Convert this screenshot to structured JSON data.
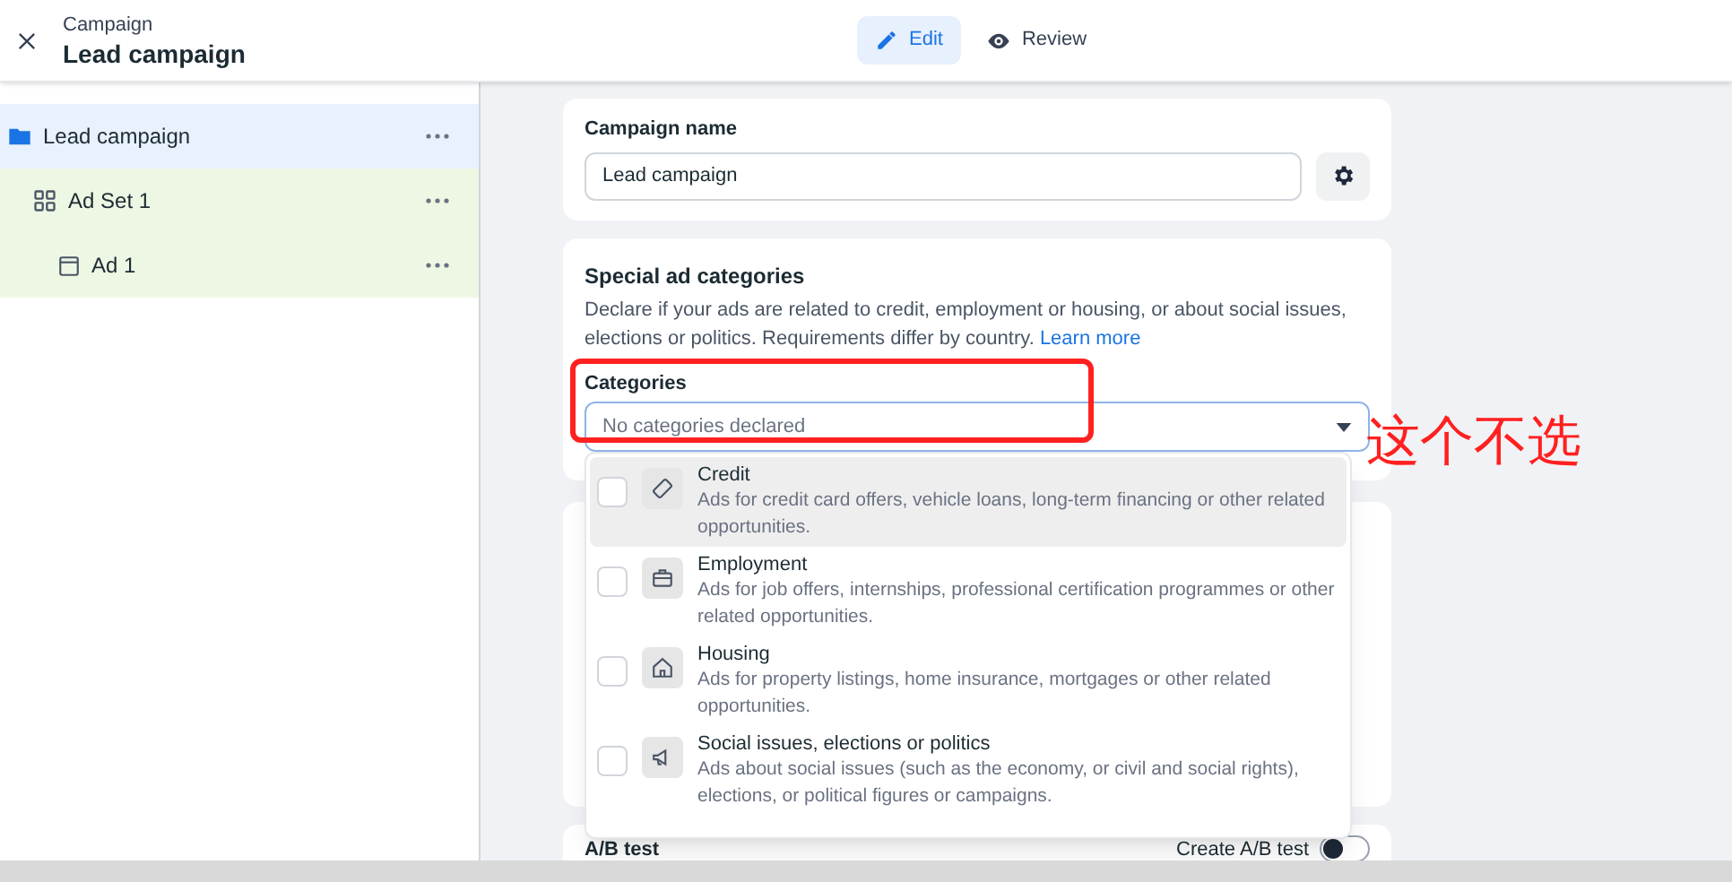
{
  "header": {
    "subtitle": "Campaign",
    "title": "Lead campaign"
  },
  "tabs": [
    {
      "label": "Edit",
      "kind": "edit",
      "selected": true
    },
    {
      "label": "Review",
      "kind": "review",
      "selected": false
    }
  ],
  "tree": [
    {
      "label": "Lead campaign",
      "kind": "campaign",
      "selected": true,
      "children": [
        {
          "label": "Ad Set 1",
          "kind": "adset",
          "selected": false,
          "children": [
            {
              "label": "Ad 1",
              "kind": "ad",
              "selected": false
            }
          ]
        }
      ]
    }
  ],
  "campaign_name": {
    "label": "Campaign name",
    "value": "Lead campaign"
  },
  "special_ad_categories": {
    "title": "Special ad categories",
    "description": "Declare if your ads are related to credit, employment or housing, or about social issues, elections or politics. Requirements differ by country.",
    "link": "Learn more",
    "field_label": "Categories",
    "placeholder": "No categories declared"
  },
  "category_options": [
    {
      "title": "Credit",
      "kind": "credit",
      "description": "Ads for credit card offers, vehicle loans, long-term financing or other related opportunities.",
      "checked": false,
      "highlighted": true
    },
    {
      "title": "Employment",
      "kind": "employment",
      "description": "Ads for job offers, internships, professional certification programmes or other related opportunities.",
      "checked": false,
      "highlighted": false
    },
    {
      "title": "Housing",
      "kind": "housing",
      "description": "Ads for property listings, home insurance, mortgages or other related opportunities.",
      "checked": false,
      "highlighted": false
    },
    {
      "title": "Social issues, elections or politics",
      "kind": "social",
      "description": "Ads about social issues (such as the economy, or civil and social rights), elections, or political figures or campaigns.",
      "checked": false,
      "highlighted": false
    }
  ],
  "ab_test": {
    "title": "A/B test",
    "toggle_label": "Create A/B test",
    "on": false
  },
  "annotation": {
    "text": "这个不选"
  }
}
